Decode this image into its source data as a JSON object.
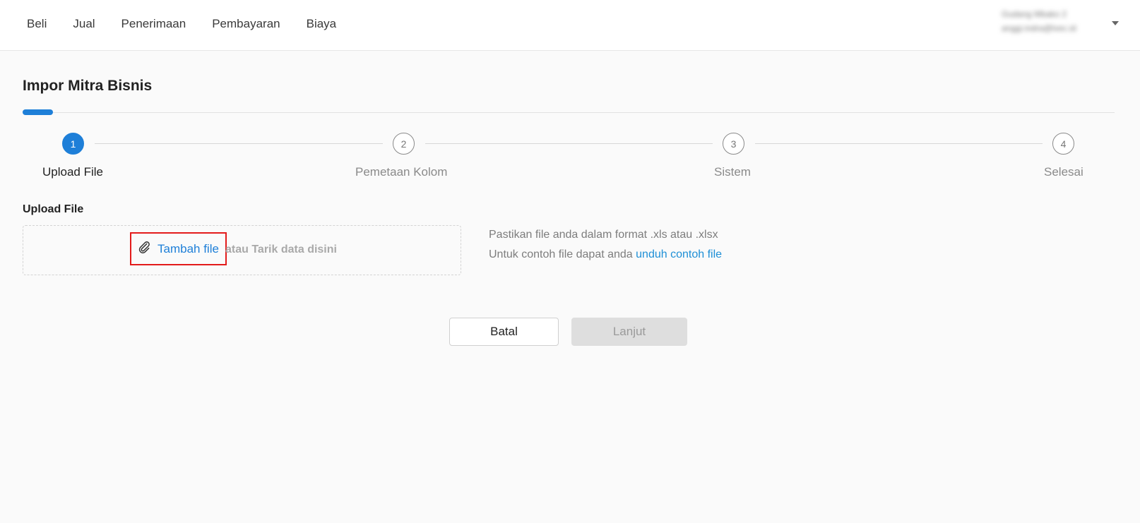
{
  "nav": {
    "items": [
      {
        "label": "Beli"
      },
      {
        "label": "Jual"
      },
      {
        "label": "Penerimaan"
      },
      {
        "label": "Pembayaran"
      },
      {
        "label": "Biaya"
      }
    ]
  },
  "user": {
    "line1": "Gudang Mbako 2",
    "line2": "anggi.indra@lvec.id"
  },
  "page": {
    "title": "Impor Mitra Bisnis"
  },
  "stepper": {
    "steps": [
      {
        "number": "1",
        "label": "Upload File",
        "active": true
      },
      {
        "number": "2",
        "label": "Pemetaan Kolom",
        "active": false
      },
      {
        "number": "3",
        "label": "Sistem",
        "active": false
      },
      {
        "number": "4",
        "label": "Selesai",
        "active": false
      }
    ]
  },
  "upload": {
    "section_label": "Upload File",
    "add_file_link": "Tambah file",
    "drop_text": "atau Tarik data disini",
    "hint_line1": "Pastikan file anda dalam format .xls atau .xlsx",
    "hint_line2_prefix": "Untuk contoh file dapat anda ",
    "hint_line2_link": "unduh contoh file"
  },
  "actions": {
    "cancel_label": "Batal",
    "next_label": "Lanjut"
  },
  "colors": {
    "accent": "#1e7fd8",
    "highlight_box": "#e31b1b",
    "disabled_button": "#dedede"
  },
  "icons": {
    "attach": "paperclip-icon",
    "user_menu": "caret-down-icon"
  }
}
